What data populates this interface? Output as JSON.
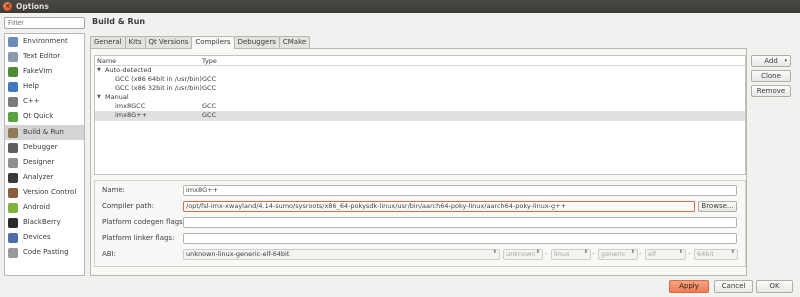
{
  "window": {
    "title": "Options",
    "close_glyph": "×"
  },
  "sidebar": {
    "filter_placeholder": "Filter",
    "items": [
      {
        "label": "Environment",
        "icon": "environment-icon",
        "color": "#6c8db9"
      },
      {
        "label": "Text Editor",
        "icon": "text-editor-icon",
        "color": "#8a9aae"
      },
      {
        "label": "FakeVim",
        "icon": "fakevim-icon",
        "color": "#4f8a37"
      },
      {
        "label": "Help",
        "icon": "help-icon",
        "color": "#3f77c1"
      },
      {
        "label": "C++",
        "icon": "cpp-icon",
        "color": "#7a7a7a"
      },
      {
        "label": "Qt Quick",
        "icon": "qt-quick-icon",
        "color": "#55a33a"
      },
      {
        "label": "Build & Run",
        "icon": "build-run-icon",
        "color": "#8f7a55"
      },
      {
        "label": "Debugger",
        "icon": "debugger-icon",
        "color": "#5e5e5e"
      },
      {
        "label": "Designer",
        "icon": "designer-icon",
        "color": "#8f8f8f"
      },
      {
        "label": "Analyzer",
        "icon": "analyzer-icon",
        "color": "#3a3a3a"
      },
      {
        "label": "Version Control",
        "icon": "version-control-icon",
        "color": "#8a5d3a"
      },
      {
        "label": "Android",
        "icon": "android-icon",
        "color": "#7fb33a"
      },
      {
        "label": "BlackBerry",
        "icon": "blackberry-icon",
        "color": "#2b2b2b"
      },
      {
        "label": "Devices",
        "icon": "devices-icon",
        "color": "#4d6fa5"
      },
      {
        "label": "Code Pasting",
        "icon": "code-pasting-icon",
        "color": "#9a9a9a"
      }
    ],
    "active_index": 6
  },
  "page": {
    "title": "Build & Run"
  },
  "tabs": [
    {
      "label": "General"
    },
    {
      "label": "Kits"
    },
    {
      "label": "Qt Versions"
    },
    {
      "label": "Compilers"
    },
    {
      "label": "Debuggers"
    },
    {
      "label": "CMake"
    }
  ],
  "active_tab": 3,
  "compilers": {
    "columns": [
      "Name",
      "Type"
    ],
    "rows": [
      {
        "name": "Auto-detected",
        "type": "",
        "group": true
      },
      {
        "name": "GCC (x86 64bit in /usr/bin)",
        "type": "GCC",
        "group": false
      },
      {
        "name": "GCC (x86 32bit in /usr/bin)",
        "type": "GCC",
        "group": false
      },
      {
        "name": "Manual",
        "type": "",
        "group": true
      },
      {
        "name": "imx8GCC",
        "type": "GCC",
        "group": false
      },
      {
        "name": "imx8G++",
        "type": "GCC",
        "group": false,
        "selected": true
      }
    ],
    "buttons": {
      "add": "Add",
      "clone": "Clone",
      "remove": "Remove"
    },
    "add_caret": "▾"
  },
  "form": {
    "name_label": "Name:",
    "name_value": "imx8G++",
    "path_label": "Compiler path:",
    "path_value": "/opt/fsl-imx-xwayland/4.14-sumo/sysroots/x86_64-pokysdk-linux/usr/bin/aarch64-poky-linux/aarch64-poky-linux-g++",
    "browse_label": "Browse...",
    "codegen_label": "Platform codegen flags:",
    "codegen_value": "",
    "linker_label": "Platform linker flags:",
    "linker_value": "",
    "abi_label": "ABI:",
    "abi_value": "unknown-linux-generic-elf-64bit",
    "abi_parts": [
      "unknown",
      "linux",
      "generic",
      "elf",
      "64bit"
    ],
    "abi_sep": "-",
    "spin_glyph": "⬍"
  },
  "dialog": {
    "apply": "Apply",
    "cancel": "Cancel",
    "ok": "OK"
  },
  "colors": {
    "accent": "#ee7b54",
    "focus_border": "#e8683e",
    "selection": "#e0e0e0"
  }
}
